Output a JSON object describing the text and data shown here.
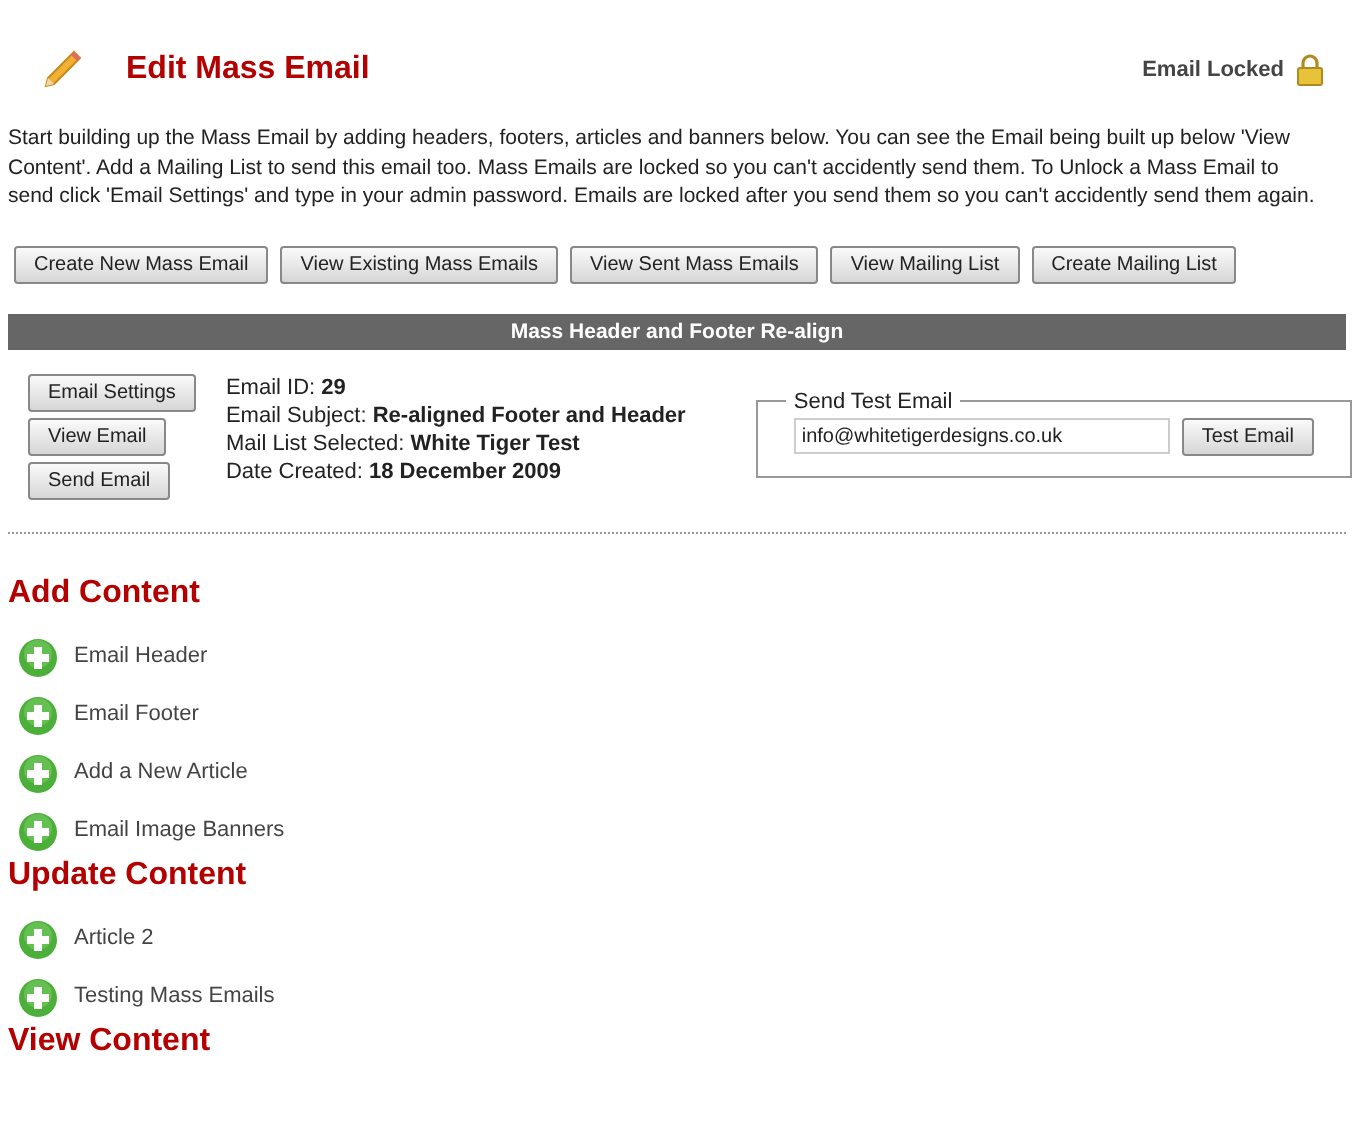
{
  "title": "Edit Mass Email",
  "lock_status": {
    "label": "Email Locked",
    "locked": true
  },
  "intro": "Start building up the Mass Email by adding headers, footers, articles and banners below. You can see the Email being built up below 'View Content'. Add a Mailing List to send this email too. Mass Emails are locked so you can't accidently send them. To Unlock a Mass Email to send click 'Email Settings' and type in your admin password. Emails are locked after you send them so you can't accidently send them again.",
  "nav_buttons": [
    "Create New Mass Email",
    "View Existing Mass Emails",
    "View Sent Mass Emails",
    "View Mailing List",
    "Create Mailing List"
  ],
  "email_panel": {
    "title": "Mass Header and Footer Re-align",
    "actions": [
      "Email Settings",
      "View Email",
      "Send Email"
    ],
    "details": [
      {
        "label": "Email ID:",
        "value": "29",
        "bold": true
      },
      {
        "label": "Email Subject:",
        "value": "Re-aligned Footer and Header",
        "bold": true
      },
      {
        "label": "Mail List Selected:",
        "value": "White Tiger Test",
        "bold": true
      },
      {
        "label": "Date Created:",
        "value": "18 December 2009",
        "bold": true
      }
    ],
    "test_email": {
      "legend": "Send Test Email",
      "value": "info@whitetigerdesigns.co.uk",
      "button": "Test Email"
    }
  },
  "sections": [
    {
      "heading": "Add Content",
      "items": [
        "Email Header",
        "Email Footer",
        "Add a New Article",
        "Email Image Banners"
      ]
    },
    {
      "heading": "Update Content",
      "items": [
        "Article 2",
        "Testing Mass Emails"
      ]
    },
    {
      "heading": "View Content"
    }
  ]
}
